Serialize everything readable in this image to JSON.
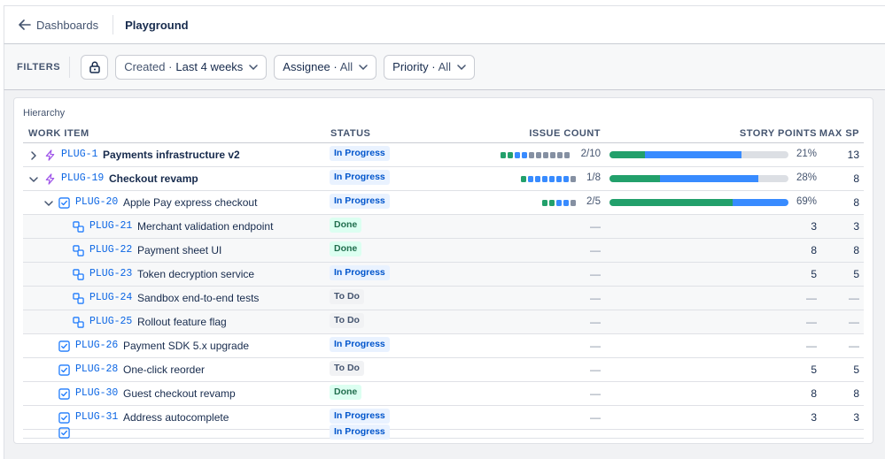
{
  "topbar": {
    "back_label": "Dashboards",
    "breadcrumb": "Playground"
  },
  "filters": {
    "label": "FILTERS",
    "created": {
      "prefix": "Created ·",
      "value": "Last 4 weeks"
    },
    "assignee": {
      "prefix": "Assignee ·",
      "value": "All"
    },
    "priority": {
      "prefix": "Priority ·",
      "value": "All"
    }
  },
  "card": {
    "title": "Hierarchy",
    "columns": {
      "work_item": "WORK ITEM",
      "status": "STATUS",
      "issue_count": "ISSUE COUNT",
      "story_points": "STORY POINTS",
      "max_sp": "MAX SP"
    }
  },
  "colors": {
    "done": "#22a06b",
    "in_progress": "#388bff",
    "todo": "#8590a2",
    "accent": "#0c66e4"
  },
  "rows": [
    {
      "level": 0,
      "expand": "collapsed",
      "type": "epic",
      "key": "PLUG-1",
      "summary": "Payments infrastructure v2",
      "bold": true,
      "status": "In Progress",
      "issue_count": "2/10",
      "dots": [
        "done",
        "done",
        "in_progress",
        "in_progress",
        "todo",
        "todo",
        "todo",
        "todo",
        "todo",
        "todo"
      ],
      "bar": {
        "done": 0.2,
        "in_progress": 0.54
      },
      "story_points": "21%",
      "max_sp": "13",
      "shaded": false
    },
    {
      "level": 0,
      "expand": "expanded",
      "type": "epic",
      "key": "PLUG-19",
      "summary": "Checkout revamp",
      "bold": true,
      "status": "In Progress",
      "issue_count": "1/8",
      "dots": [
        "done",
        "in_progress",
        "in_progress",
        "in_progress",
        "in_progress",
        "in_progress",
        "in_progress",
        "todo"
      ],
      "bar": {
        "done": 0.28,
        "in_progress": 0.55
      },
      "story_points": "28%",
      "max_sp": "8",
      "shaded": false
    },
    {
      "level": 1,
      "expand": "expanded",
      "type": "story",
      "key": "PLUG-20",
      "summary": "Apple Pay express checkout",
      "bold": false,
      "status": "In Progress",
      "issue_count": "2/5",
      "dots": [
        "done",
        "done",
        "in_progress",
        "in_progress",
        "todo"
      ],
      "bar": {
        "done": 0.69,
        "in_progress": 0.31
      },
      "story_points": "69%",
      "max_sp": "8",
      "shaded": false
    },
    {
      "level": 2,
      "type": "subtask",
      "key": "PLUG-21",
      "summary": "Merchant validation endpoint",
      "status": "Done",
      "issue_count": "—",
      "story_points": "3",
      "max_sp": "3",
      "shaded": true
    },
    {
      "level": 2,
      "type": "subtask",
      "key": "PLUG-22",
      "summary": "Payment sheet UI",
      "status": "Done",
      "issue_count": "—",
      "story_points": "8",
      "max_sp": "8",
      "shaded": true
    },
    {
      "level": 2,
      "type": "subtask",
      "key": "PLUG-23",
      "summary": "Token decryption service",
      "status": "In Progress",
      "issue_count": "—",
      "story_points": "5",
      "max_sp": "5",
      "shaded": true
    },
    {
      "level": 2,
      "type": "subtask",
      "key": "PLUG-24",
      "summary": "Sandbox end-to-end tests",
      "status": "To Do",
      "issue_count": "—",
      "story_points": "—",
      "max_sp": "—",
      "shaded": true
    },
    {
      "level": 2,
      "type": "subtask",
      "key": "PLUG-25",
      "summary": "Rollout feature flag",
      "status": "To Do",
      "issue_count": "—",
      "story_points": "—",
      "max_sp": "—",
      "shaded": true
    },
    {
      "level": 1,
      "type": "story",
      "key": "PLUG-26",
      "summary": "Payment SDK 5.x upgrade",
      "status": "In Progress",
      "issue_count": "—",
      "story_points": "—",
      "max_sp": "—",
      "shaded": false
    },
    {
      "level": 1,
      "type": "story",
      "key": "PLUG-28",
      "summary": "One-click reorder",
      "status": "To Do",
      "issue_count": "—",
      "story_points": "5",
      "max_sp": "5",
      "shaded": false
    },
    {
      "level": 1,
      "type": "story",
      "key": "PLUG-30",
      "summary": "Guest checkout revamp",
      "status": "Done",
      "issue_count": "—",
      "story_points": "8",
      "max_sp": "8",
      "shaded": false
    },
    {
      "level": 1,
      "type": "story",
      "key": "PLUG-31",
      "summary": "Address autocomplete",
      "status": "In Progress",
      "issue_count": "—",
      "story_points": "3",
      "max_sp": "3",
      "shaded": false
    },
    {
      "level": 1,
      "type": "story",
      "key": "",
      "summary": "",
      "status": "In Progress",
      "issue_count": "",
      "story_points": "",
      "max_sp": "",
      "shaded": false,
      "partial": true
    }
  ]
}
